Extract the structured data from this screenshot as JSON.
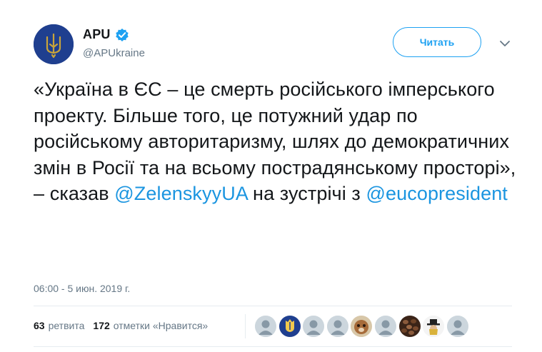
{
  "account": {
    "display_name": "APU",
    "handle": "@APUkraine",
    "verified": true,
    "avatar_icon": "trident-emblem-icon"
  },
  "follow_button": {
    "label": "Читать"
  },
  "tweet": {
    "segments": [
      {
        "text": "«Україна в ЄС – це смерть російського імперського проекту. Більше того, це потужний удар по російському авторитаризму, шлях до демократичних змін в Росії та на всьому пострадянському просторі», – сказав ",
        "type": "text"
      },
      {
        "text": "@ZelenskyyUA",
        "type": "mention"
      },
      {
        "text": " на зустрічі з ",
        "type": "text"
      },
      {
        "text": "@eucopresident",
        "type": "mention"
      }
    ],
    "timestamp": "06:00 - 5 июн. 2019 г."
  },
  "stats": {
    "retweets_count": "63",
    "retweets_label": "ретвита",
    "likes_count": "172",
    "likes_label": "отметки «Нравится»"
  },
  "likers": [
    "default-avatar-icon",
    "trident-emblem-icon",
    "default-avatar-icon",
    "default-avatar-icon",
    "animal-photo-icon",
    "default-avatar-icon",
    "coffee-beans-photo-icon",
    "hat-figure-icon",
    "default-avatar-icon"
  ],
  "colors": {
    "accent": "#1da1f2",
    "link": "#1b95e0",
    "text": "#14171a",
    "secondary_text": "#657786",
    "divider": "#e6ecf0",
    "avatar_bg": "#1f3f8f"
  }
}
